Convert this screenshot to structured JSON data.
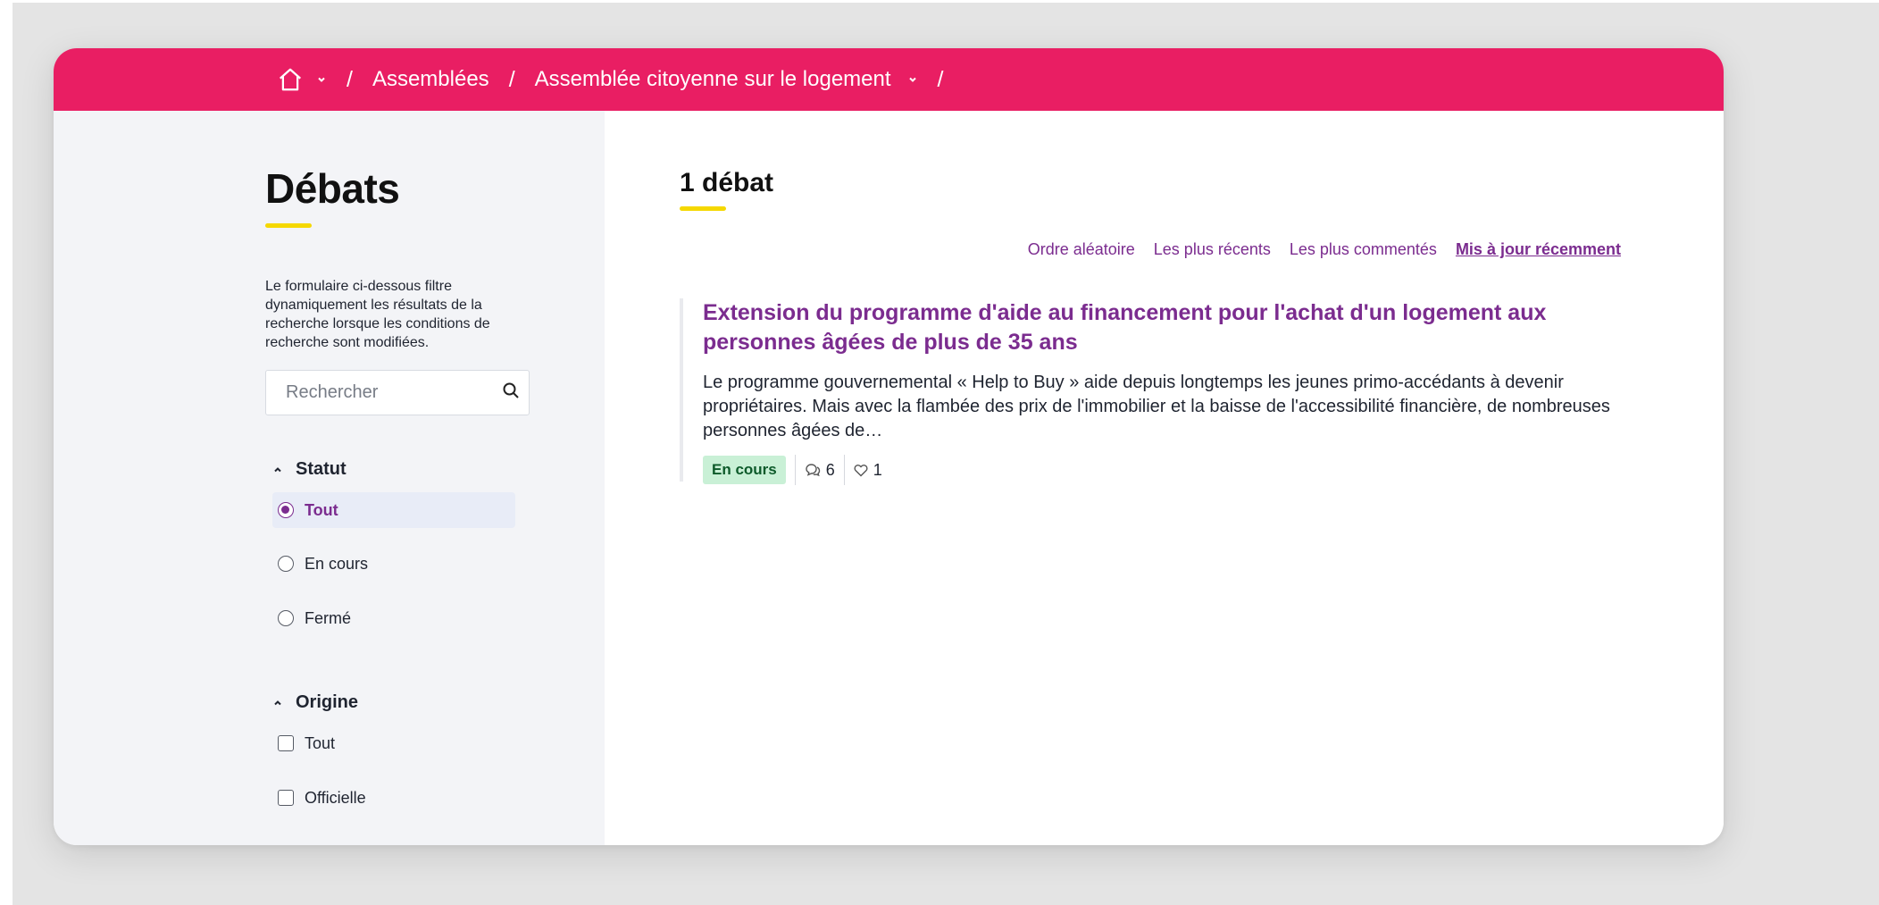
{
  "breadcrumb": {
    "items": [
      "Assemblées",
      "Assemblée citoyenne sur le logement"
    ],
    "separator": "/"
  },
  "sidebar": {
    "title": "Débats",
    "description": "Le formulaire ci-dessous filtre dynamiquement les résultats de la recherche lorsque les conditions de recherche sont modifiées.",
    "search_placeholder": "Rechercher",
    "status_filter": {
      "label": "Statut",
      "options": [
        "Tout",
        "En cours",
        "Fermé"
      ],
      "selected": "Tout"
    },
    "origin_filter": {
      "label": "Origine",
      "options": [
        "Tout",
        "Officielle"
      ]
    }
  },
  "main": {
    "count_label": "1 débat",
    "sort_options": [
      "Ordre aléatoire",
      "Les plus récents",
      "Les plus commentés",
      "Mis à jour récemment"
    ],
    "active_sort": "Mis à jour récemment",
    "debates": [
      {
        "title": "Extension du programme d'aide au financement pour l'achat d'un logement aux personnes âgées de plus de 35 ans",
        "excerpt": "Le programme gouvernemental « Help to Buy » aide depuis longtemps les jeunes primo-accédants à devenir propriétaires. Mais avec la flambée des prix de l'immobilier et la baisse de l'accessibilité financière, de nombreuses personnes âgées de…",
        "status": "En cours",
        "comments": "6",
        "likes": "1"
      }
    ]
  },
  "colors": {
    "header": "#e91e63",
    "accent": "#7b2c8f",
    "underline": "#f5d800",
    "badge_bg": "#c9f0d6"
  },
  "icons": {
    "home": "home-icon",
    "search": "search-icon",
    "comments": "comments-icon",
    "likes": "heart-icon"
  }
}
